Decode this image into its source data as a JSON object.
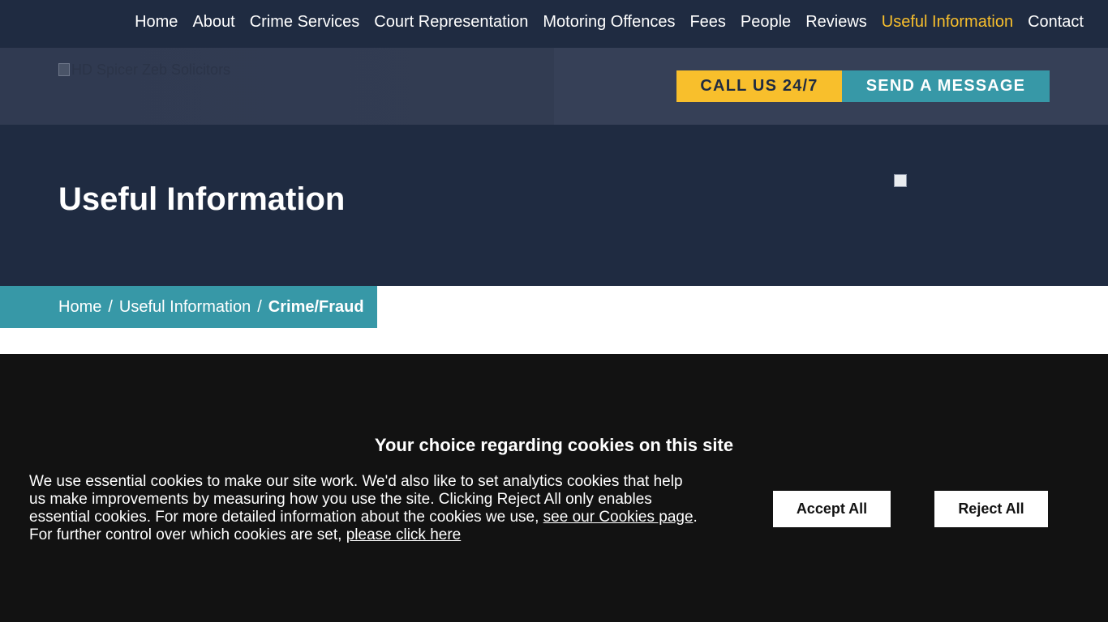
{
  "nav": {
    "items": [
      {
        "label": "Home"
      },
      {
        "label": "About"
      },
      {
        "label": "Crime Services"
      },
      {
        "label": "Court Representation"
      },
      {
        "label": "Motoring Offences"
      },
      {
        "label": "Fees"
      },
      {
        "label": "People"
      },
      {
        "label": "Reviews"
      },
      {
        "label": "Useful Information",
        "active": true
      },
      {
        "label": "Contact"
      }
    ]
  },
  "header": {
    "logo_alt": "HD Spicer Zeb Solicitors",
    "call_label": "CALL US 24/7",
    "message_label": "SEND A MESSAGE"
  },
  "hero": {
    "title": "Useful Information"
  },
  "breadcrumb": {
    "home": "Home",
    "section": "Useful Information",
    "current": "Crime/Fraud",
    "separator": "/"
  },
  "cookie": {
    "title": "Your choice regarding cookies on this site",
    "text_1": "We use essential cookies to make our site work. We'd also like to set analytics cookies that help us make improvements by measuring how you use the site. Clicking Reject All only enables essential cookies. For more detailed information about the cookies we use, ",
    "link_1": "see our Cookies page",
    "text_2": ". For further control over which cookies are set, ",
    "link_2": "please click here",
    "accept_label": "Accept All",
    "reject_label": "Reject All"
  },
  "colors": {
    "navy": "#1f2b41",
    "band": "#364057",
    "accent_yellow": "#f8bf2c",
    "accent_teal": "#3798a7",
    "cookie_bg": "#121212"
  }
}
